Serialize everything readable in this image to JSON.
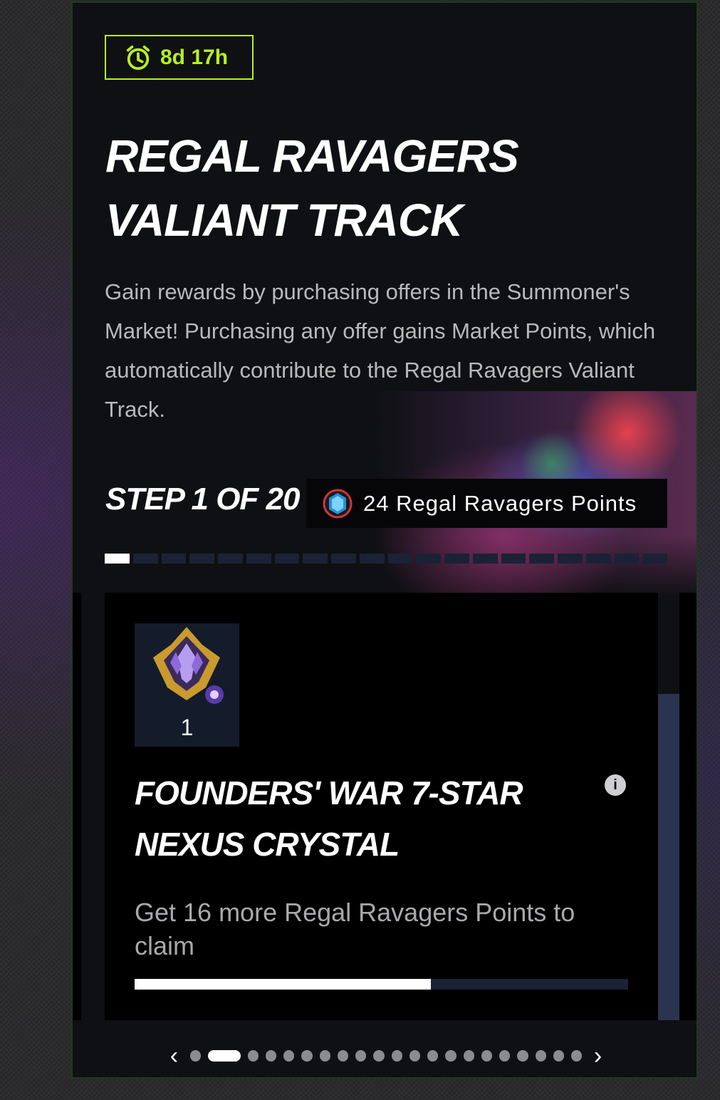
{
  "timer": {
    "text": "8d 17h",
    "icon": "alarm-clock-icon",
    "color": "#b8f01e"
  },
  "track": {
    "title": "REGAL RAVAGERS VALIANT TRACK",
    "description": "Gain rewards by purchasing offers in the Summoner's Market! Purchasing any offer gains Market Points, which automatically contribute to the Regal Ravagers Valiant Track."
  },
  "step": {
    "label": "STEP 1 OF 20",
    "current": 1,
    "total": 20,
    "points_text": "24 Regal Ravagers Points",
    "points_icon": "regal-ravagers-points-icon"
  },
  "reward": {
    "quantity": "1",
    "title": "FOUNDERS' WAR 7-STAR NEXUS CRYSTAL",
    "message": "Get 16 more Regal Ravagers Points to claim",
    "progress_fraction": 0.6,
    "info_icon": "info-icon"
  },
  "pager": {
    "total_pages": 21,
    "active_index": 1,
    "prev_icon": "chevron-left-icon",
    "next_icon": "chevron-right-icon"
  }
}
